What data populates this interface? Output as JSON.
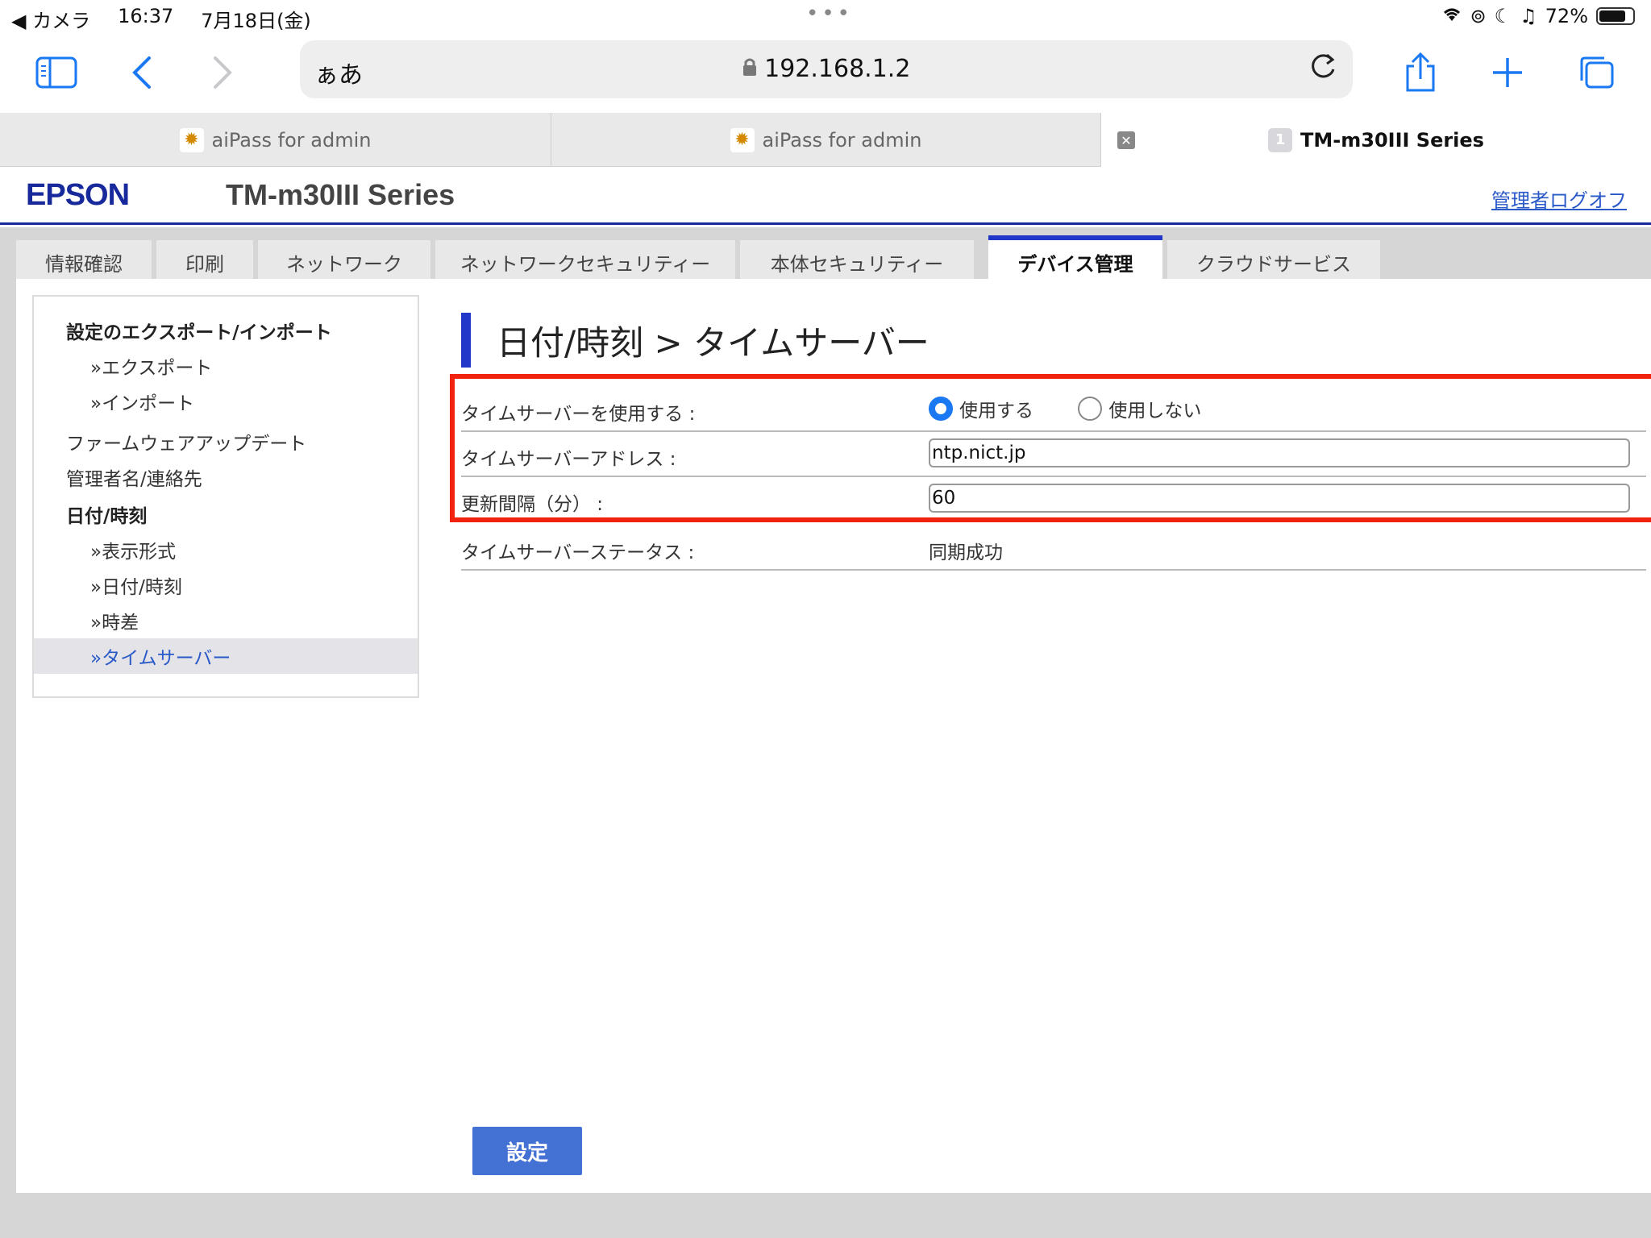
{
  "status_bar": {
    "back_app": "◀ カメラ",
    "time": "16:37",
    "date": "7月18日(金)",
    "battery": "72%"
  },
  "browser": {
    "aa_label": "ぁあ",
    "url": "192.168.1.2",
    "tabs": [
      {
        "title": "aiPass for admin"
      },
      {
        "title": "aiPass for admin"
      },
      {
        "title": "TM-m30III Series",
        "badge": "1"
      }
    ]
  },
  "header": {
    "logo": "EPSON",
    "model": "TM-m30III Series",
    "logout": "管理者ログオフ"
  },
  "nav_tabs": [
    "情報確認",
    "印刷",
    "ネットワーク",
    "ネットワークセキュリティー",
    "本体セキュリティー",
    "デバイス管理",
    "クラウドサービス"
  ],
  "side_menu": [
    {
      "label": "設定のエクスポート/インポート"
    },
    {
      "label": "»エクスポート"
    },
    {
      "label": "»インポート"
    },
    {
      "label": "ファームウェアアップデート"
    },
    {
      "label": "管理者名/連絡先"
    },
    {
      "label": "日付/時刻"
    },
    {
      "label": "»表示形式"
    },
    {
      "label": "»日付/時刻"
    },
    {
      "label": "»時差"
    },
    {
      "label": "»タイムサーバー"
    }
  ],
  "page_title": "日付/時刻 > タイムサーバー",
  "settings": {
    "use_server_label": "タイムサーバーを使用する :",
    "use_option": "使用する",
    "no_use_option": "使用しない",
    "address_label": "タイムサーバーアドレス :",
    "address_value": "ntp.nict.jp",
    "interval_label": "更新間隔（分） :",
    "interval_value": "60",
    "status_label": "タイムサーバーステータス :",
    "status_value": "同期成功"
  },
  "submit_label": "設定"
}
